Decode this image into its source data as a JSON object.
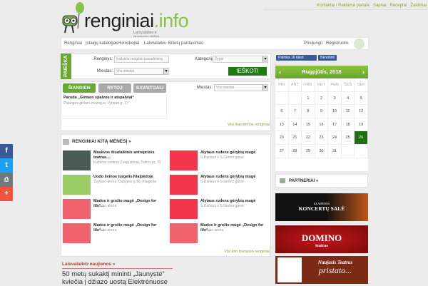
{
  "top_links": [
    "Kontaktai / Reklama portale",
    "Sapnai",
    "Receptai",
    "Žaidimai"
  ],
  "logo": {
    "text_main": "renginiai",
    "text_accent": ".info",
    "subtitle": "Laisvalaikio ir pramogų gidas"
  },
  "nav": {
    "items": [
      "Renginiai",
      "Įstaigų katalogas",
      "Horoskopai",
      "Laisvalaikis",
      "Bilietų pardavimas"
    ],
    "login": "Prisijungti",
    "register": "Registruotis"
  },
  "search": {
    "tab": "PAIEŠKA",
    "event_label": "Renginys:",
    "event_placeholder": "Įrašykite renginio pavadinimą",
    "city_label": "Miestas:",
    "city_value": "Visi miestai",
    "category_label": "Kategorija:",
    "category_value": "Žygai",
    "submit": "IEŠKOTI"
  },
  "today": {
    "tabs": [
      "ŠIANDIEN",
      "RYTOJ",
      "SAVAITGALĮ"
    ],
    "city_label": "Miestas:",
    "city_value": "Visi miestai",
    "items": [
      {
        "title": "Paroda „Gintaro spalvos ir atspalviai“",
        "sub": "Palangos gintaro muziejus, Vytauto g. 17"
      }
    ],
    "all_link": "Visi šiandienos renginiai"
  },
  "next_month": {
    "title": "RENGINIAI KITĄ MĖNESĮ »",
    "items": [
      {
        "title": "Maskvos šiuolaikinis antreprizės teatras....",
        "sub": "Kultūros centras Žvejų rūmai, Taikos pr. 70"
      },
      {
        "title": "Alytaus rudens gėrybių mugė",
        "sub": "S.Dariaus ir S.Girėno gatvė"
      },
      {
        "title": "Uodo švinos turgelis Klaipėdoje",
        "sub": "Švyturio arena, Dubysos g.10, Klaipėda"
      },
      {
        "title": "Alytaus rudens gėrybių mugė",
        "sub": "S.Dariaus ir S.Girėno gatvė"
      },
      {
        "title": "Mados ir grožio mugė „Design for life“...",
        "sub": "Švyturio arena"
      },
      {
        "title": "Alytaus rudens gėrybių mugė",
        "sub": "S.Dariaus ir S.Girėno gatvė"
      },
      {
        "title": "Mados ir grožio mugė „Design for life“...",
        "sub": "Švyturio arena"
      },
      {
        "title": "Mados ir grožio mugė „Design for life“...",
        "sub": "Švyturio arena"
      }
    ],
    "all_link": "Visi kito mėnesio renginiai"
  },
  "news": {
    "title": "Laisvalaikio naujienos »",
    "headline": "50 metų sukaktį mininti „Jaunystė“ kviečia į džiazo uostą Elektrėnuose"
  },
  "facebook": {
    "like": "Patinka 16 tūkst.",
    "share": "Bendrinti"
  },
  "calendar": {
    "title": "Rugpjūtis, 2018",
    "days": [
      "PIR",
      "ANT",
      "TRE",
      "KET",
      "PEN",
      "ŠEŠ",
      "SEK"
    ],
    "cells": [
      "",
      "",
      "1",
      "2",
      "3",
      "4",
      "5",
      "6",
      "7",
      "8",
      "9",
      "10",
      "11",
      "12",
      "13",
      "14",
      "15",
      "16",
      "17",
      "18",
      "19",
      "20",
      "21",
      "22",
      "23",
      "24",
      "25",
      "26",
      "27",
      "28",
      "29",
      "30",
      "31",
      "",
      ""
    ],
    "today": "26"
  },
  "partners": {
    "title": "PARTNERIAI »",
    "banners": [
      {
        "line1": "KLAIPĖDOS",
        "line2": "KONCERTŲ SALĖ"
      },
      {
        "line1": "DOMINO",
        "line2": "teatras"
      },
      {
        "line1": "Naujasis Teatras",
        "line2": "pristato..."
      }
    ]
  },
  "colors": {
    "green": "#6aa82f",
    "dark_green": "#1f7a12",
    "bg": "#ececec",
    "facebook": "#3b5998",
    "twitter": "#1da1f2",
    "print": "#6d7b80",
    "plus": "#f0523e"
  }
}
